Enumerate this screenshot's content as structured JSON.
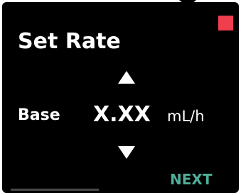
{
  "screen": {
    "title": "Set Rate",
    "label": "Base",
    "rate_value": "X.XX",
    "unit": "mL/h",
    "next_label": "NEXT",
    "increase_icon": "triangle-up-icon",
    "decrease_icon": "triangle-down-icon",
    "status_icon": "red-square-indicator",
    "progress_fraction": 1.0
  },
  "colors": {
    "screen_background": "#000000",
    "text": "#ffffff",
    "accent_next": "#4fae98",
    "status_indicator": "#ef3e4d",
    "progress": "#3a3a3a"
  }
}
